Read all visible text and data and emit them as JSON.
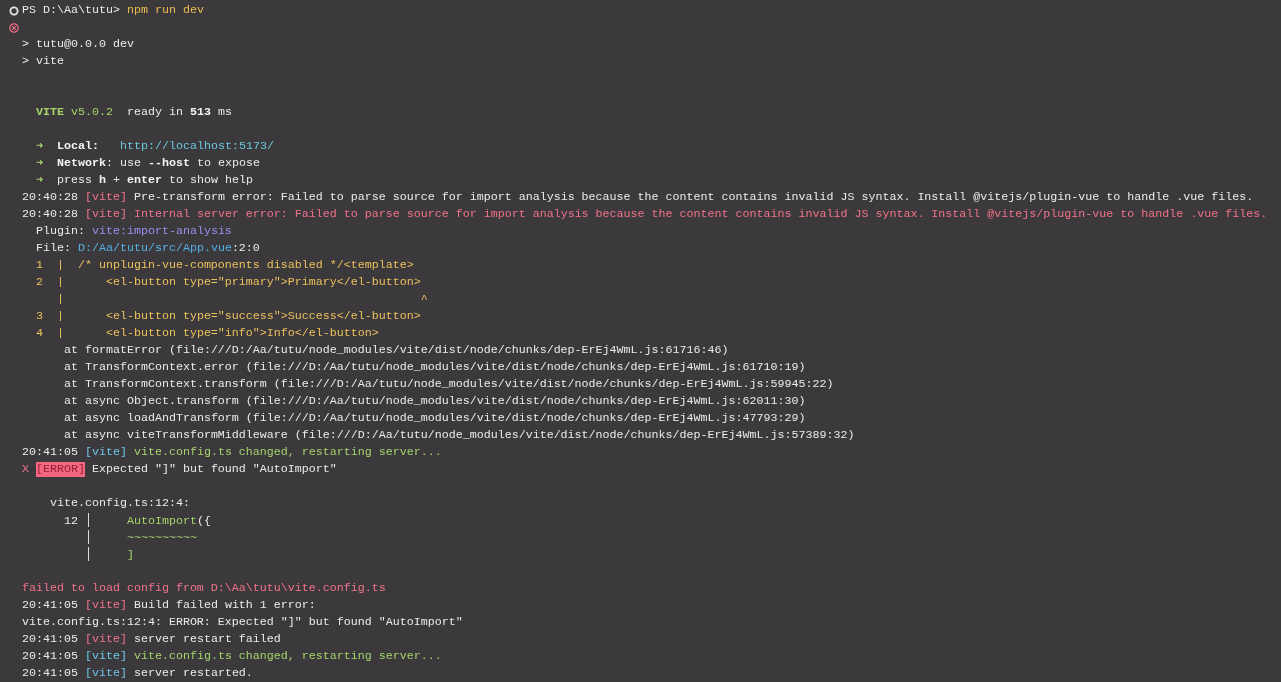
{
  "terminal": {
    "lines": [
      {
        "kind": "prompt",
        "segments": [
          {
            "text": "PS D:\\Aa\\tutu> ",
            "kind": "plain"
          },
          {
            "text": "npm run dev",
            "kind": "command"
          }
        ]
      },
      {
        "kind": "error-mark"
      },
      {
        "kind": "text",
        "segments": [
          {
            "text": "> tutu@0.0.0 dev",
            "kind": "plain"
          }
        ]
      },
      {
        "kind": "text",
        "segments": [
          {
            "text": "> vite",
            "kind": "plain"
          }
        ]
      },
      {
        "kind": "blank"
      },
      {
        "kind": "blank"
      },
      {
        "kind": "text",
        "segments": [
          {
            "text": "  VITE",
            "kind": "green-bold"
          },
          {
            "text": " v5.0.2",
            "kind": "green"
          },
          {
            "text": "  ready in ",
            "kind": "plain"
          },
          {
            "text": "513",
            "kind": "bold"
          },
          {
            "text": " ms",
            "kind": "plain"
          }
        ]
      },
      {
        "kind": "blank"
      },
      {
        "kind": "text",
        "segments": [
          {
            "text": "  ➜  ",
            "kind": "green"
          },
          {
            "text": "Local:   ",
            "kind": "bold"
          },
          {
            "text": "http://localhost:5173/",
            "kind": "link"
          }
        ]
      },
      {
        "kind": "text",
        "segments": [
          {
            "text": "  ➜  ",
            "kind": "green"
          },
          {
            "text": "Network",
            "kind": "bold"
          },
          {
            "text": ": use ",
            "kind": "plain"
          },
          {
            "text": "--host",
            "kind": "bold"
          },
          {
            "text": " to expose",
            "kind": "plain"
          }
        ]
      },
      {
        "kind": "text",
        "segments": [
          {
            "text": "  ➜  ",
            "kind": "green"
          },
          {
            "text": "press ",
            "kind": "plain"
          },
          {
            "text": "h",
            "kind": "bold"
          },
          {
            "text": " + ",
            "kind": "plain"
          },
          {
            "text": "enter",
            "kind": "bold"
          },
          {
            "text": " to show help",
            "kind": "plain"
          }
        ]
      },
      {
        "kind": "text",
        "segments": [
          {
            "text": "20:40:28 ",
            "kind": "plain"
          },
          {
            "text": "[vite]",
            "kind": "red"
          },
          {
            "text": " Pre-transform error: Failed to parse source for import analysis because the content contains invalid JS syntax. Install @vitejs/plugin-vue to handle .vue files.",
            "kind": "plain"
          }
        ]
      },
      {
        "kind": "text",
        "segments": [
          {
            "text": "20:40:28 ",
            "kind": "plain"
          },
          {
            "text": "[vite]",
            "kind": "red"
          },
          {
            "text": " Internal server error: Failed to parse source for import analysis because the content contains invalid JS syntax. Install @vitejs/plugin-vue to handle .vue files.",
            "kind": "red"
          }
        ]
      },
      {
        "kind": "text",
        "segments": [
          {
            "text": "  Plugin: ",
            "kind": "plain"
          },
          {
            "text": "vite:import-analysis",
            "kind": "purple"
          }
        ]
      },
      {
        "kind": "text",
        "segments": [
          {
            "text": "  File: ",
            "kind": "plain"
          },
          {
            "text": "D:/Aa/tutu/src/App.vue",
            "kind": "path"
          },
          {
            "text": ":2:0",
            "kind": "plain"
          }
        ]
      },
      {
        "kind": "text",
        "segments": [
          {
            "text": "  1  |  /* unplugin-vue-components disabled */<template>",
            "kind": "code"
          }
        ]
      },
      {
        "kind": "text",
        "segments": [
          {
            "text": "  2  |      <el-button type=\"primary\">Primary</el-button>",
            "kind": "code"
          }
        ]
      },
      {
        "kind": "text",
        "segments": [
          {
            "text": "     |                                                   ^",
            "kind": "code"
          }
        ]
      },
      {
        "kind": "text",
        "segments": [
          {
            "text": "  3  |      <el-button type=\"success\">Success</el-button>",
            "kind": "code"
          }
        ]
      },
      {
        "kind": "text",
        "segments": [
          {
            "text": "  4  |      <el-button type=\"info\">Info</el-button>",
            "kind": "code"
          }
        ]
      },
      {
        "kind": "text",
        "segments": [
          {
            "text": "      at formatError (file:///D:/Aa/tutu/node_modules/vite/dist/node/chunks/dep-ErEj4WmL.js:61716:46)",
            "kind": "plain"
          }
        ]
      },
      {
        "kind": "text",
        "segments": [
          {
            "text": "      at TransformContext.error (file:///D:/Aa/tutu/node_modules/vite/dist/node/chunks/dep-ErEj4WmL.js:61710:19)",
            "kind": "plain"
          }
        ]
      },
      {
        "kind": "text",
        "segments": [
          {
            "text": "      at TransformContext.transform (file:///D:/Aa/tutu/node_modules/vite/dist/node/chunks/dep-ErEj4WmL.js:59945:22)",
            "kind": "plain"
          }
        ]
      },
      {
        "kind": "text",
        "segments": [
          {
            "text": "      at async Object.transform (file:///D:/Aa/tutu/node_modules/vite/dist/node/chunks/dep-ErEj4WmL.js:62011:30)",
            "kind": "plain"
          }
        ]
      },
      {
        "kind": "text",
        "segments": [
          {
            "text": "      at async loadAndTransform (file:///D:/Aa/tutu/node_modules/vite/dist/node/chunks/dep-ErEj4WmL.js:47793:29)",
            "kind": "plain"
          }
        ]
      },
      {
        "kind": "text",
        "segments": [
          {
            "text": "      at async viteTransformMiddleware (file:///D:/Aa/tutu/node_modules/vite/dist/node/chunks/dep-ErEj4WmL.js:57389:32)",
            "kind": "plain"
          }
        ]
      },
      {
        "kind": "text",
        "segments": [
          {
            "text": "20:41:05 ",
            "kind": "plain"
          },
          {
            "text": "[vite]",
            "kind": "cyan"
          },
          {
            "text": " vite.config.ts changed, restarting server...",
            "kind": "green"
          }
        ]
      },
      {
        "kind": "text",
        "segments": [
          {
            "text": "X ",
            "kind": "red"
          },
          {
            "text": "[ERROR]",
            "kind": "badge"
          },
          {
            "text": " Expected \"]\" but found \"AutoImport\"",
            "kind": "plain"
          }
        ]
      },
      {
        "kind": "blank"
      },
      {
        "kind": "text",
        "segments": [
          {
            "text": "    vite.config.ts:12:4:",
            "kind": "plain"
          }
        ]
      },
      {
        "kind": "text",
        "segments": [
          {
            "text": "      12 ",
            "kind": "plain"
          },
          {
            "text": "│",
            "kind": "frame"
          },
          {
            "text": "     AutoImport",
            "kind": "green"
          },
          {
            "text": "({",
            "kind": "plain"
          }
        ]
      },
      {
        "kind": "text",
        "segments": [
          {
            "text": "         │",
            "kind": "frame"
          },
          {
            "text": "     ~~~~~~~~~~",
            "kind": "green"
          }
        ]
      },
      {
        "kind": "text",
        "segments": [
          {
            "text": "         │",
            "kind": "frame"
          },
          {
            "text": "     ]",
            "kind": "green"
          }
        ]
      },
      {
        "kind": "blank"
      },
      {
        "kind": "text",
        "segments": [
          {
            "text": "failed to load config from D:\\Aa\\tutu\\vite.config.ts",
            "kind": "red"
          }
        ]
      },
      {
        "kind": "text",
        "segments": [
          {
            "text": "20:41:05 ",
            "kind": "plain"
          },
          {
            "text": "[vite]",
            "kind": "red"
          },
          {
            "text": " Build failed with 1 error:",
            "kind": "plain"
          }
        ]
      },
      {
        "kind": "text",
        "segments": [
          {
            "text": "vite.config.ts:12:4: ERROR: Expected \"]\" but found \"AutoImport\"",
            "kind": "plain"
          }
        ]
      },
      {
        "kind": "text",
        "segments": [
          {
            "text": "20:41:05 ",
            "kind": "plain"
          },
          {
            "text": "[vite]",
            "kind": "red"
          },
          {
            "text": " server restart failed",
            "kind": "plain"
          }
        ]
      },
      {
        "kind": "text",
        "segments": [
          {
            "text": "20:41:05 ",
            "kind": "plain"
          },
          {
            "text": "[vite]",
            "kind": "cyan"
          },
          {
            "text": " vite.config.ts changed, restarting server...",
            "kind": "green"
          }
        ]
      },
      {
        "kind": "text",
        "segments": [
          {
            "text": "20:41:05 ",
            "kind": "plain"
          },
          {
            "text": "[vite]",
            "kind": "cyan"
          },
          {
            "text": " server restarted.",
            "kind": "plain"
          }
        ]
      }
    ]
  }
}
